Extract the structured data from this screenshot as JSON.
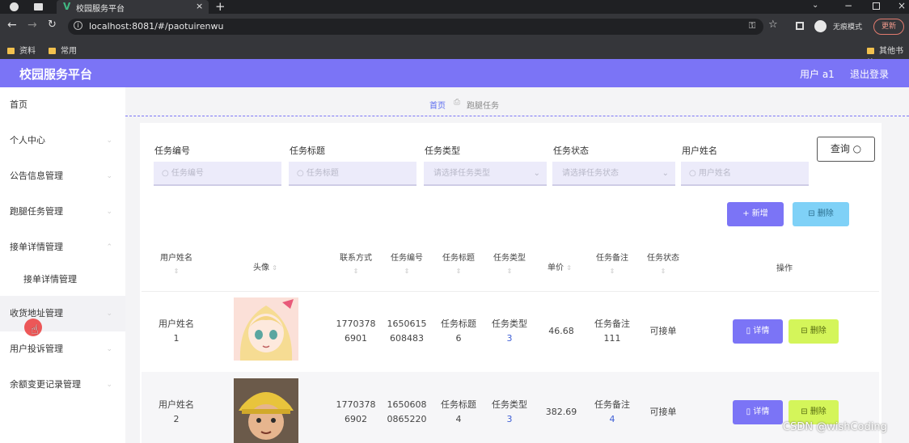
{
  "browser": {
    "tab_title": "校园服务平台",
    "url": "localhost:8081/#/paotuirenwu",
    "incognito_label": "无痕模式",
    "update_label": "更新",
    "bookmarks": [
      "资料",
      "常用"
    ],
    "other_bookmarks": "其他书签"
  },
  "header": {
    "title": "校园服务平台",
    "user_label": "用户 a1",
    "logout_label": "退出登录"
  },
  "sidebar": {
    "items": [
      {
        "label": "首页"
      },
      {
        "label": "个人中心"
      },
      {
        "label": "公告信息管理"
      },
      {
        "label": "跑腿任务管理"
      },
      {
        "label": "接单详情管理"
      },
      {
        "label": "接单详情管理"
      },
      {
        "label": "收货地址管理"
      },
      {
        "label": "用户投诉管理"
      },
      {
        "label": "余额变更记录管理"
      }
    ]
  },
  "breadcrumb": {
    "home": "首页",
    "current": "跑腿任务"
  },
  "filters": [
    {
      "label": "任务编号",
      "placeholder": "任务编号"
    },
    {
      "label": "任务标题",
      "placeholder": "任务标题"
    },
    {
      "label": "任务类型",
      "placeholder": "请选择任务类型"
    },
    {
      "label": "任务状态",
      "placeholder": "请选择任务状态"
    },
    {
      "label": "用户姓名",
      "placeholder": "用户姓名"
    }
  ],
  "actions": {
    "query": "查询",
    "add": "新增",
    "delete": "删除"
  },
  "table": {
    "headers": [
      "用户姓名",
      "头像",
      "联系方式",
      "任务编号",
      "任务标题",
      "任务类型",
      "单价",
      "任务备注",
      "任务状态",
      "操作"
    ],
    "rows": [
      {
        "name": [
          "用户姓名",
          "1"
        ],
        "phone": [
          "1770378",
          "6901"
        ],
        "task_no": [
          "1650615",
          "608483"
        ],
        "title": [
          "任务标题",
          "6"
        ],
        "type": [
          "任务类型",
          "3"
        ],
        "price": "46.68",
        "remark": [
          "任务备注",
          "111"
        ],
        "status": "可接单",
        "detail": "详情",
        "delete": "删除"
      },
      {
        "name": [
          "用户姓名",
          "2"
        ],
        "phone": [
          "1770378",
          "6902"
        ],
        "task_no": [
          "1650608",
          "0865220"
        ],
        "title": [
          "任务标题",
          "4"
        ],
        "type": [
          "任务类型",
          "3"
        ],
        "price": "382.69",
        "remark": [
          "任务备注",
          "4"
        ],
        "status": "可接单",
        "detail": "详情",
        "delete": "删除"
      }
    ]
  },
  "watermark": "CSDN @wishCoding",
  "colors": {
    "accent": "#7b74f6",
    "info": "#7fd1f7",
    "lime": "#d4f55a",
    "link": "#3f5fd6"
  }
}
